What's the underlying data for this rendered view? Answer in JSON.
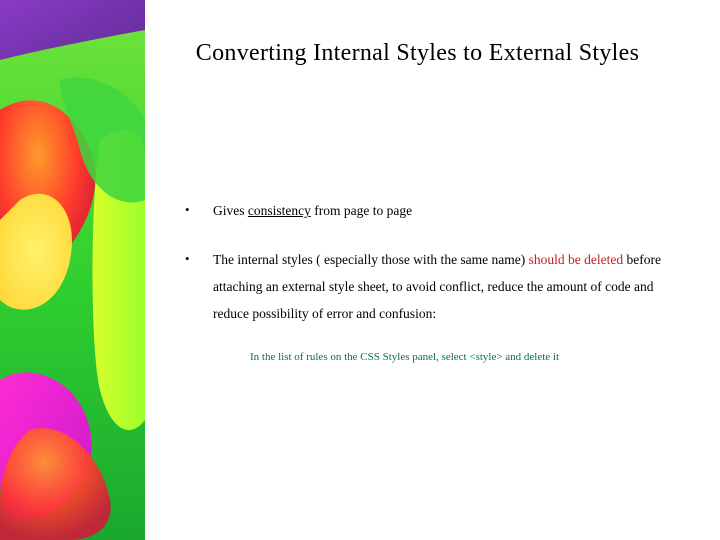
{
  "title": "Converting Internal Styles to External Styles",
  "bullets": [
    {
      "pre": "Gives ",
      "underlined": "consistency",
      "post": " from page to page"
    },
    {
      "pre": "The internal styles ( especially those with the same name) ",
      "red": "should be deleted",
      "post": " before attaching an external style sheet, to avoid conflict, reduce the amount of code and reduce possibility of error and confusion:"
    }
  ],
  "note": "In the list of rules on the CSS Styles panel, select <style> and delete it"
}
